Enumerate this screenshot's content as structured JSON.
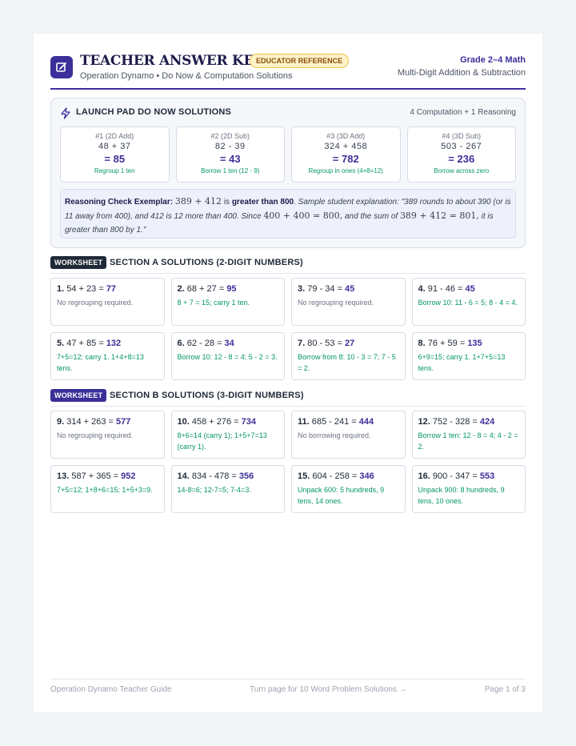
{
  "header": {
    "title": "TEACHER ANSWER KEY",
    "badge": "EDUCATOR REFERENCE",
    "subtitle": "Operation Dynamo • Do Now & Computation Solutions",
    "grade": "Grade 2–4 Math",
    "topic": "Multi-Digit Addition & Subtraction",
    "logo_icon": "edit-square-icon"
  },
  "launch_pad": {
    "title": "LAUNCH PAD DO NOW SOLUTIONS",
    "count": "4 Computation + 1 Reasoning",
    "icon": "lightning-icon",
    "problems": [
      {
        "label": "#1 (2D Add)",
        "expr": "48  +  37",
        "answer": "=  85",
        "note": "Regroup 1 ten"
      },
      {
        "label": "#2 (2D Sub)",
        "expr": "82  -  39",
        "answer": "=  43",
        "note": "Borrow 1 ten (12 - 9)"
      },
      {
        "label": "#3 (3D Add)",
        "expr": "324  +  458",
        "answer": "=  782",
        "note": "Regroup in ones (4+8=12)"
      },
      {
        "label": "#4 (3D Sub)",
        "expr": "503  -  267",
        "answer": "=  236",
        "note": "Borrow across zero"
      }
    ],
    "reasoning": {
      "label": "Reasoning Check Exemplar:",
      "math1": "389 + 412",
      "is": "is",
      "claim": "greater than 800",
      "text1": ". Sample student explanation: \"389 rounds to about 390 (or is 11 away from 400), and 412 is 12 more than 400. Since",
      "math2": "400 + 400 = 800,",
      "text2": "and the sum of",
      "math3": "389 + 412 = 801,",
      "text3": "it is greater than 800 by 1.\""
    }
  },
  "section_a": {
    "tag": "WORKSHEET",
    "title": "SECTION A SOLUTIONS (2-DIGIT NUMBERS)",
    "tag_color": "#1f2937",
    "items": [
      {
        "num": "1.",
        "expr": "54 + 23 =",
        "ans": "77",
        "note": "No regrouping required.",
        "kind": "g"
      },
      {
        "num": "2.",
        "expr": "68 + 27 =",
        "ans": "95",
        "note": "8 + 7 = 15; carry 1 ten.",
        "kind": "gr"
      },
      {
        "num": "3.",
        "expr": "79 - 34 =",
        "ans": "45",
        "note": "No regrouping required.",
        "kind": "g"
      },
      {
        "num": "4.",
        "expr": "91 - 46 =",
        "ans": "45",
        "note": "Borrow 10: 11 - 6 = 5; 8 - 4 = 4.",
        "kind": "gr"
      },
      {
        "num": "5.",
        "expr": "47 + 85 =",
        "ans": "132",
        "note": "7+5=12; carry 1. 1+4+8=13 tens.",
        "kind": "gr"
      },
      {
        "num": "6.",
        "expr": "62 - 28 =",
        "ans": "34",
        "note": "Borrow 10: 12 - 8 = 4; 5 - 2 = 3.",
        "kind": "gr"
      },
      {
        "num": "7.",
        "expr": "80 - 53 =",
        "ans": "27",
        "note": "Borrow from 8: 10 - 3 = 7; 7 - 5 = 2.",
        "kind": "gr"
      },
      {
        "num": "8.",
        "expr": "76 + 59 =",
        "ans": "135",
        "note": "6+9=15; carry 1. 1+7+5=13 tens.",
        "kind": "gr"
      }
    ]
  },
  "section_b": {
    "tag": "WORKSHEET",
    "title": "SECTION B SOLUTIONS (3-DIGIT NUMBERS)",
    "tag_color": "#3b2f99",
    "items": [
      {
        "num": "9.",
        "expr": "314 + 263 =",
        "ans": "577",
        "note": "No regrouping required.",
        "kind": "g"
      },
      {
        "num": "10.",
        "expr": "458 + 276 =",
        "ans": "734",
        "note": "8+6=14 (carry 1); 1+5+7=13 (carry 1).",
        "kind": "gr"
      },
      {
        "num": "11.",
        "expr": "685 - 241 =",
        "ans": "444",
        "note": "No borrowing required.",
        "kind": "g"
      },
      {
        "num": "12.",
        "expr": "752 - 328 =",
        "ans": "424",
        "note": "Borrow 1 ten: 12 - 8 = 4; 4 - 2 = 2.",
        "kind": "gr"
      },
      {
        "num": "13.",
        "expr": "587 + 365 =",
        "ans": "952",
        "note": "7+5=12; 1+8+6=15; 1+5+3=9.",
        "kind": "gr"
      },
      {
        "num": "14.",
        "expr": "834 - 478 =",
        "ans": "356",
        "note": "14-8=6; 12-7=5; 7-4=3.",
        "kind": "gr"
      },
      {
        "num": "15.",
        "expr": "604 - 258 =",
        "ans": "346",
        "note": "Unpack 600: 5 hundreds, 9 tens, 14 ones.",
        "kind": "gr"
      },
      {
        "num": "16.",
        "expr": "900 - 347 =",
        "ans": "553",
        "note": "Unpack 900: 8 hundreds, 9 tens, 10 ones.",
        "kind": "gr"
      }
    ]
  },
  "footer": {
    "left": "Operation Dynamo Teacher Guide",
    "middle": "Turn page for 10 Word Problem Solutions →",
    "right": "Page 1 of 3"
  }
}
